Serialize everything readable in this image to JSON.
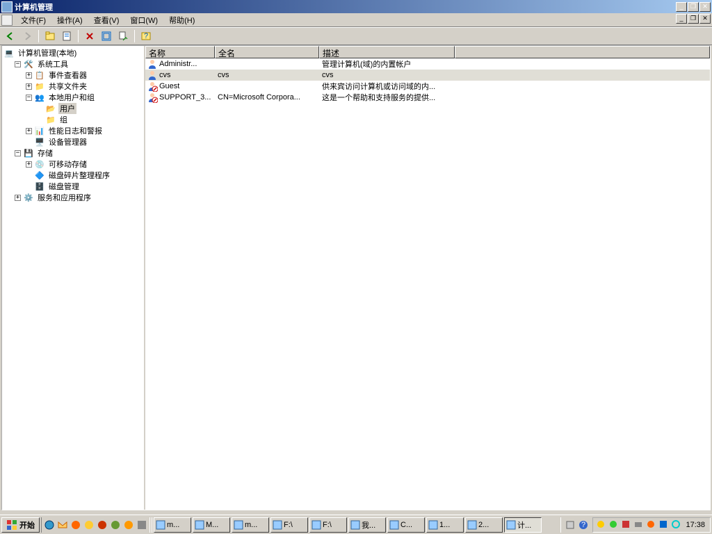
{
  "window": {
    "title": "计算机管理"
  },
  "menu": {
    "file": "文件(F)",
    "action": "操作(A)",
    "view": "查看(V)",
    "window": "窗口(W)",
    "help": "帮助(H)"
  },
  "tree": {
    "root": "计算机管理(本地)",
    "system_tools": "系统工具",
    "event_viewer": "事件查看器",
    "shared_folders": "共享文件夹",
    "local_users_groups": "本地用户和组",
    "users": "用户",
    "groups": "组",
    "perf_logs": "性能日志和警报",
    "device_manager": "设备管理器",
    "storage": "存储",
    "removable_storage": "可移动存储",
    "disk_defrag": "磁盘碎片整理程序",
    "disk_mgmt": "磁盘管理",
    "services_apps": "服务和应用程序"
  },
  "list": {
    "columns": {
      "name": "名称",
      "fullname": "全名",
      "description": "描述"
    },
    "rows": [
      {
        "name": "Administr...",
        "fullname": "",
        "description": "管理计算机(域)的内置帐户",
        "disabled": false
      },
      {
        "name": "cvs",
        "fullname": "cvs",
        "description": "cvs",
        "disabled": false,
        "selected": true
      },
      {
        "name": "Guest",
        "fullname": "",
        "description": "供来宾访问计算机或访问域的内...",
        "disabled": true
      },
      {
        "name": "SUPPORT_3...",
        "fullname": "CN=Microsoft Corpora...",
        "description": "这是一个帮助和支持服务的提供...",
        "disabled": true
      }
    ]
  },
  "taskbar": {
    "start": "开始",
    "tasks": [
      {
        "label": "m..."
      },
      {
        "label": "M..."
      },
      {
        "label": "m..."
      },
      {
        "label": "F:\\"
      },
      {
        "label": "F:\\"
      },
      {
        "label": "我..."
      },
      {
        "label": "C..."
      },
      {
        "label": "1..."
      },
      {
        "label": "2..."
      },
      {
        "label": "计...",
        "active": true
      }
    ],
    "clock": "17:38"
  }
}
